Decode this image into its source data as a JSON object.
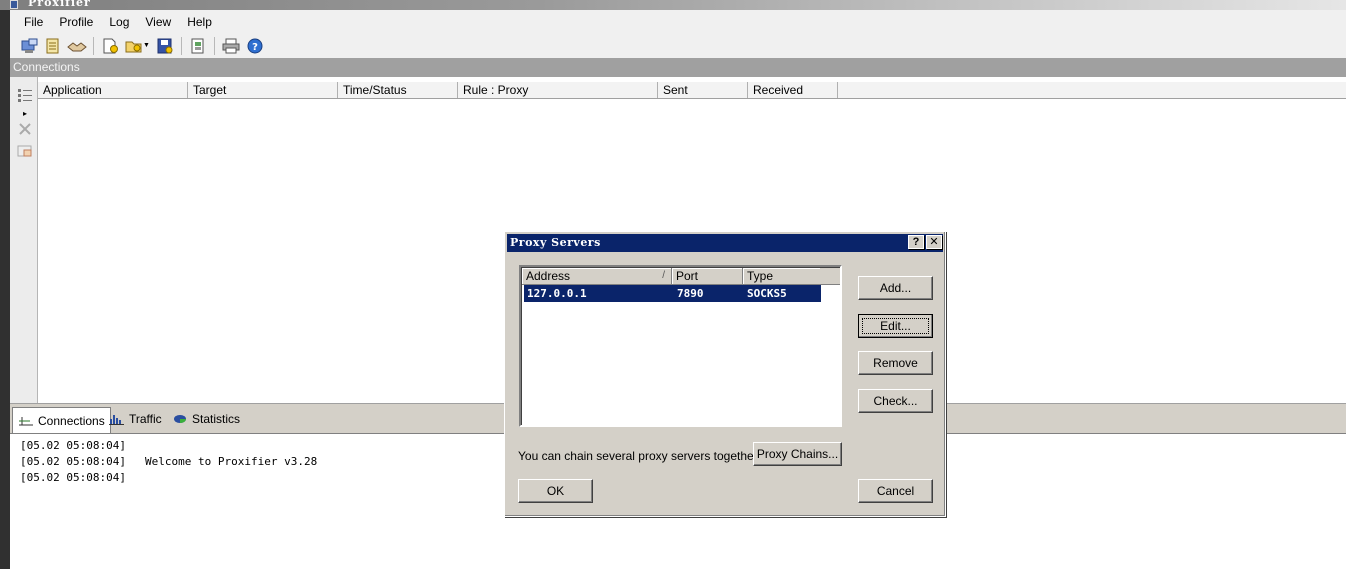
{
  "window": {
    "title": "Proxifier"
  },
  "menu": [
    "File",
    "Profile",
    "Log",
    "View",
    "Help"
  ],
  "toolbar_icons": [
    "connection-list-icon",
    "profile-icon",
    "handshake-icon",
    "new-profile-icon",
    "open-profile-icon",
    "save-icon",
    "profile-settings-icon",
    "print-icon",
    "help-icon"
  ],
  "connections": {
    "section_title": "Connections",
    "columns": [
      "Application",
      "Target",
      "Time/Status",
      "Rule : Proxy",
      "Sent",
      "Received"
    ]
  },
  "tabs": [
    {
      "label": "Connections",
      "icon": "connections-tab-icon",
      "active": true
    },
    {
      "label": "Traffic",
      "icon": "traffic-chart-icon",
      "active": false
    },
    {
      "label": "Statistics",
      "icon": "pie-chart-icon",
      "active": false
    }
  ],
  "log": [
    {
      "time": "[05.02 05:08:04]",
      "message": ""
    },
    {
      "time": "[05.02 05:08:04]",
      "message": "Welcome to Proxifier v3.28"
    },
    {
      "time": "[05.02 05:08:04]",
      "message": ""
    }
  ],
  "dialog": {
    "title": "Proxy Servers",
    "help_label": "?",
    "close_label": "✕",
    "columns": [
      "Address",
      "Port",
      "Type"
    ],
    "sort_indicator": "/",
    "servers": [
      {
        "address": "127.0.0.1",
        "port": "7890",
        "type": "SOCKS5",
        "selected": true
      }
    ],
    "buttons": {
      "add": "Add...",
      "edit": "Edit...",
      "remove": "Remove",
      "check": "Check...",
      "proxy_chains": "Proxy Chains...",
      "ok": "OK",
      "cancel": "Cancel"
    },
    "chain_text": "You can chain several proxy servers together:"
  },
  "colors": {
    "selection": "#0a246a",
    "dialog_face": "#d4d0c8",
    "section_header": "#a0a0a0"
  }
}
